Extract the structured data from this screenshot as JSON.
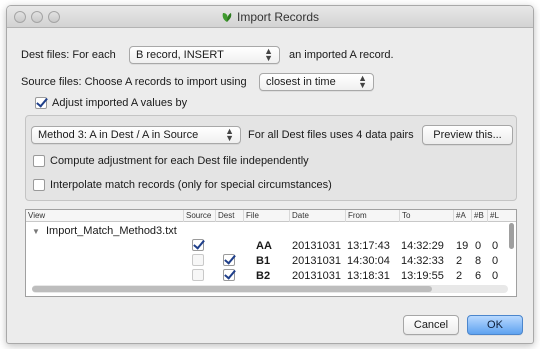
{
  "window": {
    "title": "Import Records"
  },
  "dest": {
    "prefix": "Dest files: For each",
    "popup_value": "B record, INSERT",
    "suffix": "an imported A record."
  },
  "source": {
    "label": "Source files: Choose A records to import using",
    "popup_value": "closest in time"
  },
  "adjust": {
    "label": "Adjust imported A values by",
    "checked": true
  },
  "method": {
    "popup_value": "Method 3: A in Dest / A in Source",
    "info": "For all Dest files uses 4 data pairs",
    "preview_button": "Preview this..."
  },
  "options": {
    "compute_label": "Compute adjustment for each Dest file independently",
    "interpolate_label": "Interpolate match records (only for special circumstances)"
  },
  "table": {
    "columns": [
      "View",
      "Source",
      "Dest",
      "File",
      "Date",
      "From",
      "To",
      "#A",
      "#B",
      "#L"
    ],
    "group_name": "Import_Match_Method3.txt",
    "rows": [
      {
        "source": true,
        "dest": false,
        "file": "AA",
        "date": "20131031",
        "from": "13:17:43",
        "to": "14:32:29",
        "a": "19",
        "b": "0",
        "l": "0"
      },
      {
        "source": false,
        "dest": true,
        "file": "B1",
        "date": "20131031",
        "from": "14:30:04",
        "to": "14:32:33",
        "a": "2",
        "b": "8",
        "l": "0"
      },
      {
        "source": false,
        "dest": true,
        "file": "B2",
        "date": "20131031",
        "from": "13:18:31",
        "to": "13:19:55",
        "a": "2",
        "b": "6",
        "l": "0"
      }
    ]
  },
  "buttons": {
    "cancel": "Cancel",
    "ok": "OK"
  },
  "colors": {
    "accent": "#5fa2f0",
    "check": "#1f3f8a",
    "app_icon": "#3f9a2e"
  }
}
